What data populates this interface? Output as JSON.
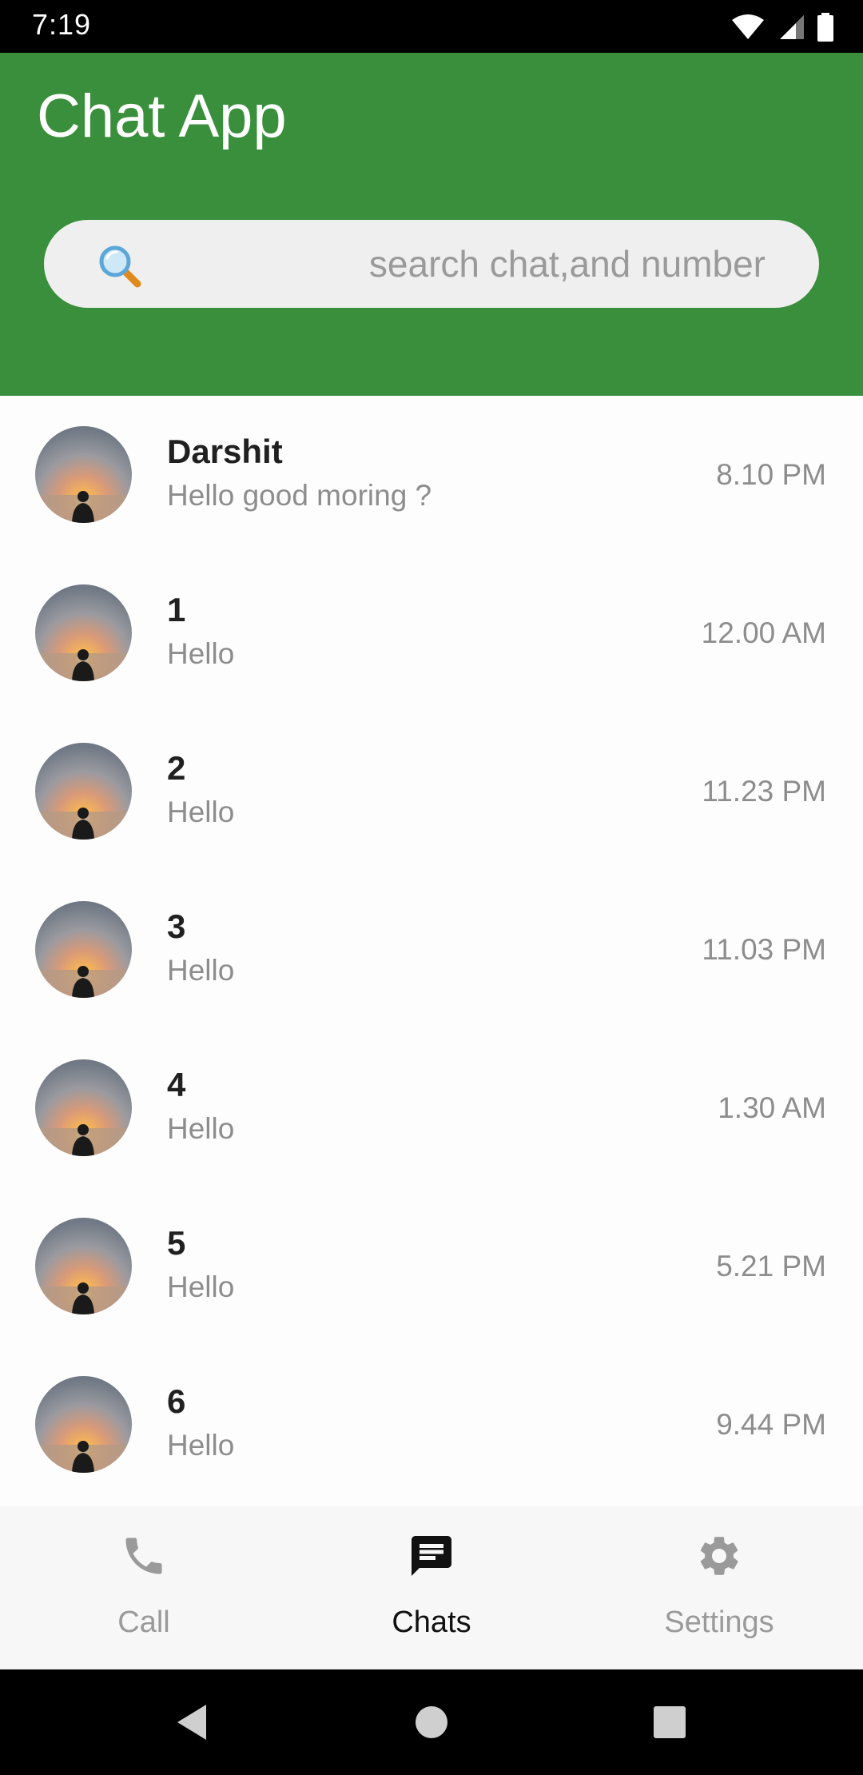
{
  "status_bar": {
    "time": "7:19"
  },
  "header": {
    "title": "Chat App",
    "search_placeholder": "search chat,and number"
  },
  "chats": [
    {
      "name": "Darshit",
      "message": "Hello good moring ?",
      "time": "8.10 PM"
    },
    {
      "name": "1",
      "message": "Hello",
      "time": "12.00 AM"
    },
    {
      "name": "2",
      "message": "Hello",
      "time": "11.23 PM"
    },
    {
      "name": "3",
      "message": "Hello",
      "time": "11.03 PM"
    },
    {
      "name": "4",
      "message": "Hello",
      "time": "1.30 AM"
    },
    {
      "name": "5",
      "message": "Hello",
      "time": "5.21 PM"
    },
    {
      "name": "6",
      "message": "Hello",
      "time": "9.44 PM"
    }
  ],
  "bottom_nav": {
    "items": [
      {
        "label": "Call",
        "icon": "phone-icon",
        "active": false
      },
      {
        "label": "Chats",
        "icon": "chat-icon",
        "active": true
      },
      {
        "label": "Settings",
        "icon": "gear-icon",
        "active": false
      }
    ]
  },
  "colors": {
    "primary": "#3a8f3c",
    "active_nav": "#111111",
    "inactive_nav": "#9a9a9a"
  }
}
